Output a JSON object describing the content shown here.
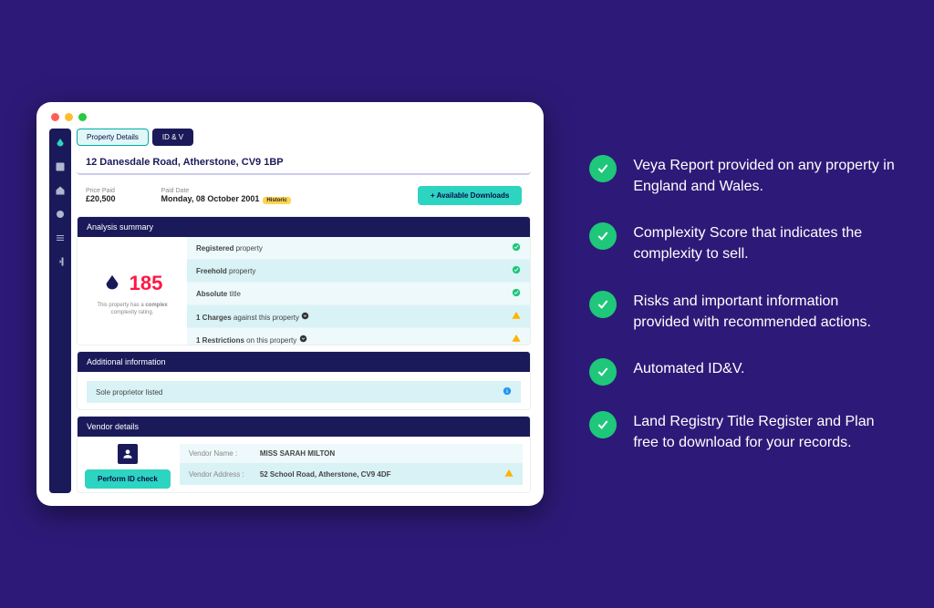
{
  "tabs": {
    "details": "Property Details",
    "idv": "ID & V"
  },
  "address": "12 Danesdale Road, Atherstone, CV9 1BP",
  "price": {
    "label": "Price Paid",
    "value": "£20,500"
  },
  "paid": {
    "label": "Paid Date",
    "value": "Monday, 08 October 2001",
    "badge": "Historic"
  },
  "download": "+ Available Downloads",
  "analysis": {
    "title": "Analysis summary",
    "score": "185",
    "note_pre": "This property has a ",
    "note_b": "complex",
    "note_post": " complexity rating.",
    "items": [
      {
        "b": "Registered",
        "t": " property",
        "s": "ok"
      },
      {
        "b": "Freehold",
        "t": " property",
        "s": "ok"
      },
      {
        "b": "Absolute",
        "t": " title",
        "s": "ok"
      },
      {
        "b": "1 Charges",
        "t": " against this property ",
        "s": "warn",
        "exp": true
      },
      {
        "b": "1 Restrictions",
        "t": " on this property ",
        "s": "warn",
        "exp": true
      }
    ]
  },
  "additional": {
    "title": "Additional information",
    "sole": "Sole proprietor listed"
  },
  "vendor": {
    "title": "Vendor details",
    "idcheck": "Perform ID check",
    "name_lbl": "Vendor Name :",
    "name": "MISS SARAH MILTON",
    "addr_lbl": "Vendor Address :",
    "addr": "52 School Road, Atherstone, CV9 4DF"
  },
  "features": [
    "Veya Report provided on any property in England and Wales.",
    "Complexity Score that indicates the complexity to sell.",
    "Risks and important information provided with recommended actions.",
    "Automated ID&V.",
    "Land Registry Title Register and Plan free to download for your records."
  ]
}
